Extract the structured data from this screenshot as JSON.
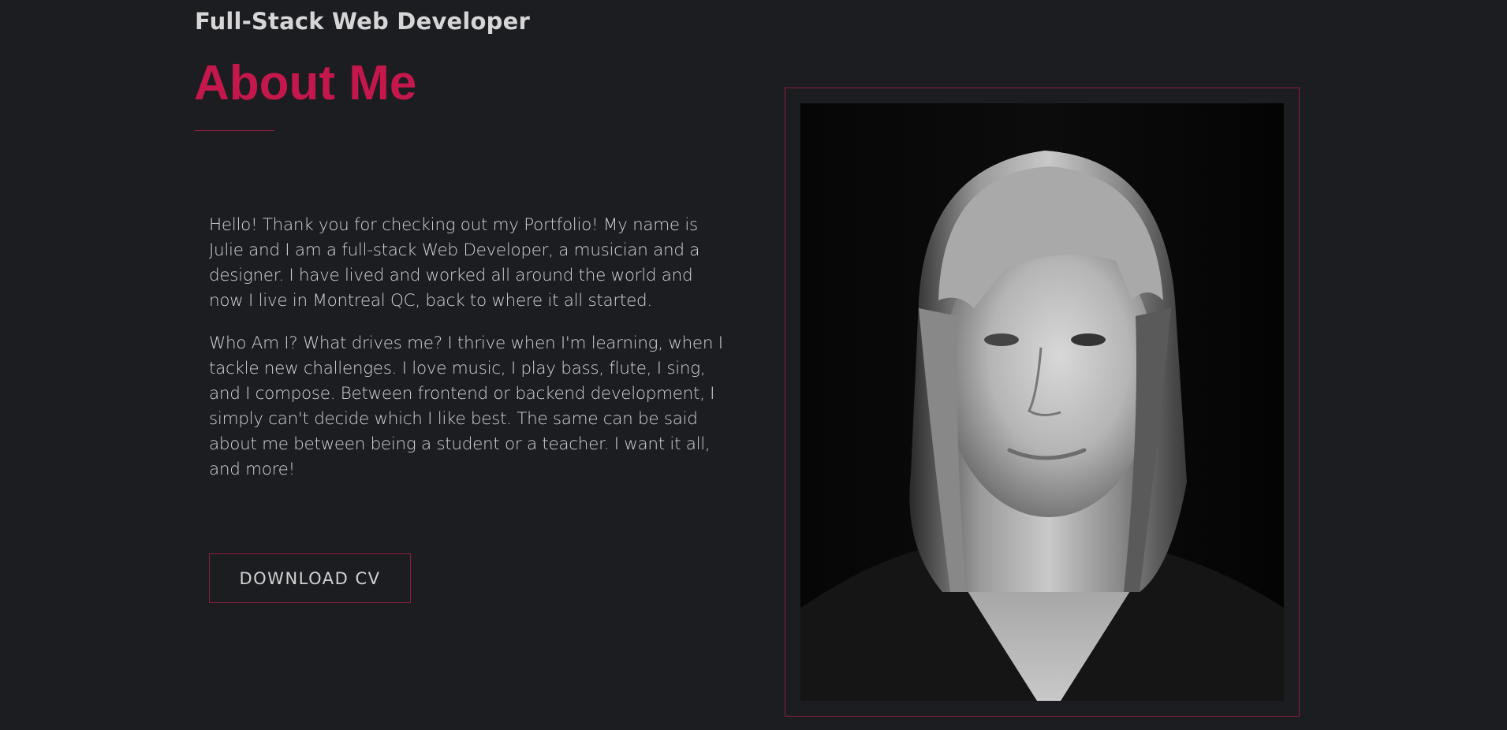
{
  "header": {
    "subtitle": "Full-Stack Web Developer",
    "title": "About Me"
  },
  "about": {
    "paragraphs": [
      "Hello! Thank you for checking out my Portfolio! My name is Julie and I am a full-stack Web Developer, a musician and a designer. I have lived and worked all around the world and now I live in Montreal QC, back to where it all started.",
      "Who Am I? What drives me? I thrive when I'm learning, when I tackle new challenges. I love music, I play bass, flute, I sing, and I compose. Between frontend or backend development, I simply can't decide which I like best. The same can be said about me between being a student or a teacher. I want it all, and more!"
    ],
    "button_label": "DOWNLOAD CV"
  },
  "photo": {
    "subject": "black-and-white portrait of a woman with shoulder-length hair and bangs"
  },
  "colors": {
    "background": "#1c1d21",
    "accent": "#c4174c",
    "border": "#8a1f3d",
    "text": "#d2d2d4"
  }
}
